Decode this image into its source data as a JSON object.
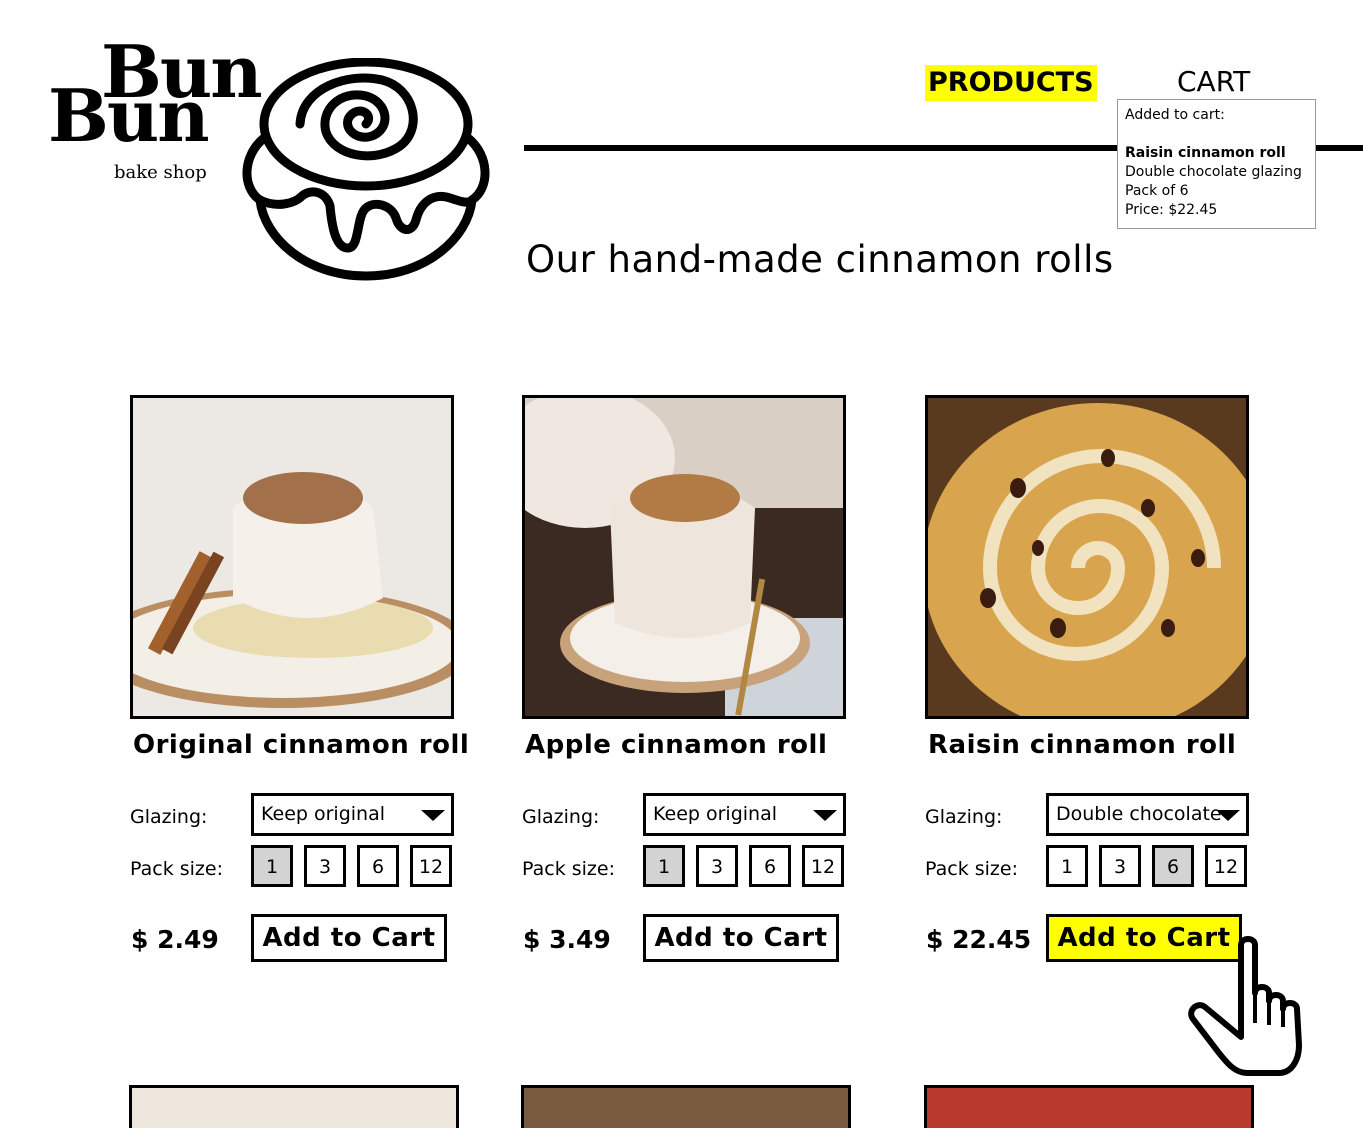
{
  "brand": {
    "line1": "Bun",
    "line2": "Bun",
    "tagline": "bake shop",
    "logo_icon": "cinnamon-roll-icon"
  },
  "nav": {
    "products": "PRODUCTS",
    "cart": "CART",
    "highlight_color": "#ffff00"
  },
  "cart_popup": {
    "heading": "Added to cart:",
    "item": "Raisin cinnamon roll",
    "glazing": "Double chocolate glazing",
    "pack": "Pack of 6",
    "price": "Price: $22.45"
  },
  "page_title": "Our hand-made cinnamon rolls",
  "labels": {
    "glazing": "Glazing:",
    "pack_size": "Pack size:",
    "add_to_cart": "Add to Cart",
    "currency": "$"
  },
  "products": [
    {
      "name": "Original cinnamon roll",
      "glazing": "Keep original",
      "pack_sizes": [
        "1",
        "3",
        "6",
        "12"
      ],
      "selected_pack": "1",
      "price": "$ 2.49",
      "image": "frosted-cinnamon-roll-photo"
    },
    {
      "name": "Apple cinnamon roll",
      "glazing": "Keep original",
      "pack_sizes": [
        "1",
        "3",
        "6",
        "12"
      ],
      "selected_pack": "1",
      "price": "$ 3.49",
      "image": "apple-cinnamon-roll-photo"
    },
    {
      "name": "Raisin cinnamon roll",
      "glazing": "Double chocolate",
      "pack_sizes": [
        "1",
        "3",
        "6",
        "12"
      ],
      "selected_pack": "6",
      "price": "$ 22.45",
      "image": "raisin-swirl-photo"
    }
  ]
}
